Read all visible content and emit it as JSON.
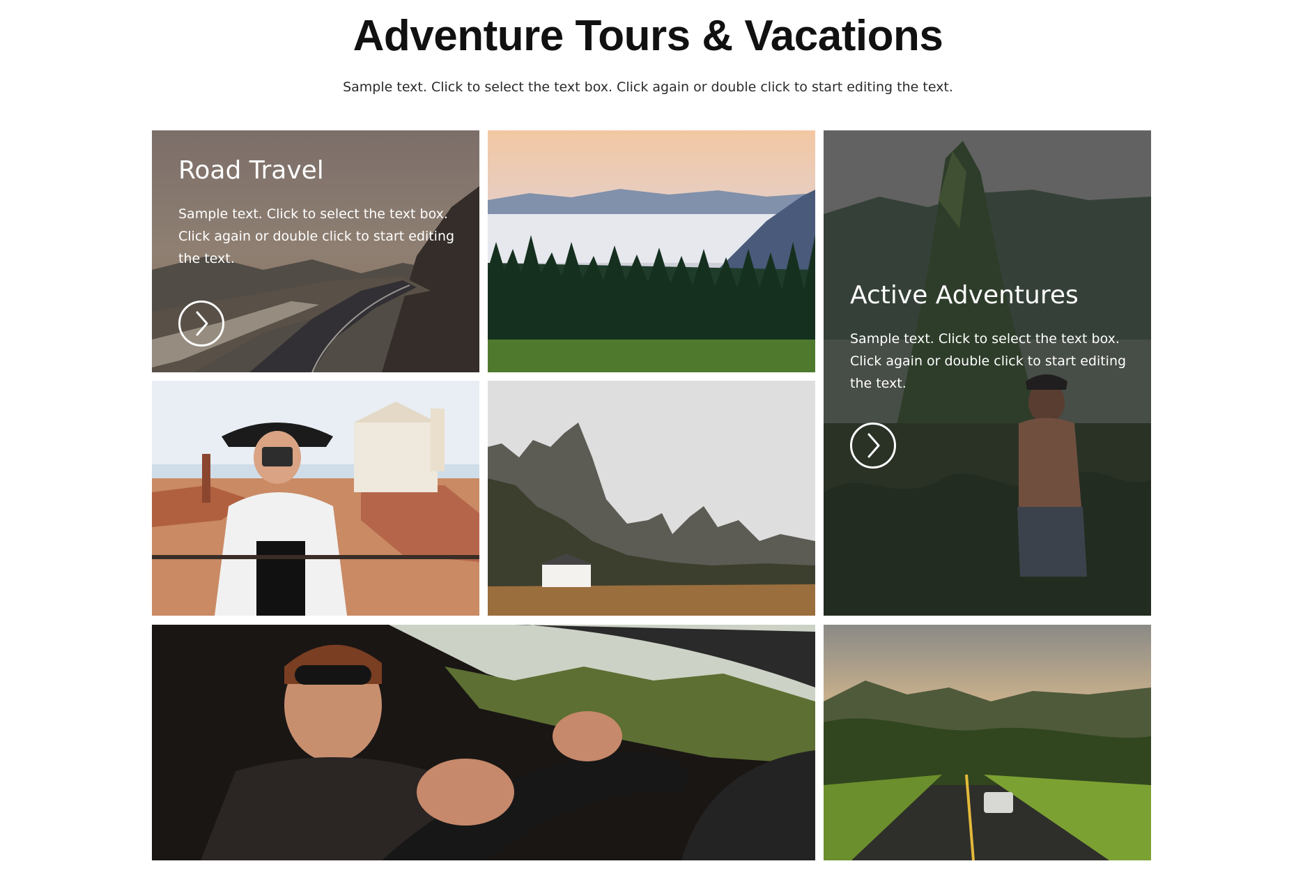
{
  "header": {
    "title": "Adventure Tours & Vacations",
    "subtitle": "Sample text. Click to select the text box. Click again or double click to start editing the text."
  },
  "cards": {
    "road_travel": {
      "heading": "Road Travel",
      "body": "Sample text. Click to select the text box. Click again or double click to start editing the text.",
      "button_icon": "chevron-right-icon"
    },
    "active_adventures": {
      "heading": "Active Adventures",
      "body": "Sample text. Click to select the text box. Click again or double click to start editing the text.",
      "button_icon": "chevron-right-icon"
    }
  },
  "colors": {
    "overlay": "#2a2426",
    "title_text": "#111111",
    "card_text": "#ffffff"
  }
}
